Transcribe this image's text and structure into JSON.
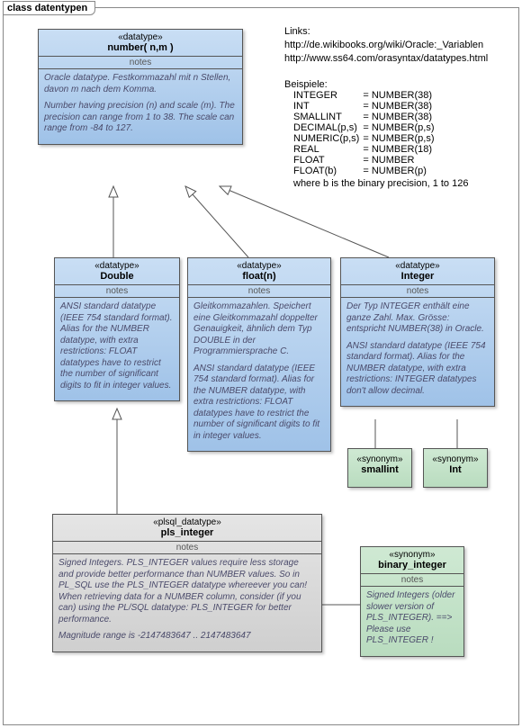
{
  "frame": {
    "title": "class datentypen"
  },
  "links_heading": "Links:",
  "links": [
    "http://de.wikibooks.org/wiki/Oracle:_Variablen",
    "http://www.ss64.com/orasyntax/datatypes.html"
  ],
  "examples": {
    "heading": "Beispiele:",
    "rows": [
      {
        "l": "INTEGER",
        "r": "= NUMBER(38)"
      },
      {
        "l": "INT",
        "r": "= NUMBER(38)"
      },
      {
        "l": "SMALLINT",
        "r": "= NUMBER(38)"
      },
      {
        "l": "DECIMAL(p,s)",
        "r": "= NUMBER(p,s)"
      },
      {
        "l": "NUMERIC(p,s)",
        "r": "= NUMBER(p,s)"
      },
      {
        "l": "REAL",
        "r": "= NUMBER(18)"
      },
      {
        "l": "FLOAT",
        "r": "= NUMBER"
      },
      {
        "l": "FLOAT(b)",
        "r": "= NUMBER(p)"
      }
    ],
    "footer": "where b is the binary precision, 1 to 126"
  },
  "notes_label": "notes",
  "classes": {
    "number": {
      "ster": "«datatype»",
      "name": "number( n,m )",
      "notes": [
        "Oracle datatype. Festkommazahl mit n Stellen, davon m nach dem Komma.",
        "Number having precision (n) and scale (m). The precision can range from 1 to 38. The scale can range from -84 to 127."
      ]
    },
    "double": {
      "ster": "«datatype»",
      "name": "Double",
      "notes": [
        "ANSI standard datatype (IEEE 754 standard format). Alias for the NUMBER datatype, with extra restrictions: FLOAT datatypes have to restrict the number of significant digits to fit in integer values."
      ]
    },
    "float": {
      "ster": "«datatype»",
      "name": "float(n)",
      "notes": [
        "Gleitkommazahlen. Speichert eine Gleitkommazahl doppelter Genauigkeit, ähnlich dem Typ DOUBLE in der Programmiersprache C.",
        "ANSI standard datatype (IEEE 754 standard format). Alias for the NUMBER datatype, with extra restrictions: FLOAT datatypes have to restrict the number of significant digits to fit in integer values."
      ]
    },
    "integer": {
      "ster": "«datatype»",
      "name": "Integer",
      "notes": [
        "Der Typ INTEGER enthält eine ganze Zahl. Max. Grösse: entspricht NUMBER(38) in Oracle.",
        "ANSI standard datatype (IEEE 754 standard format). Alias for the NUMBER datatype, with extra restrictions: INTEGER datatypes don't allow decimal."
      ]
    },
    "smallint": {
      "ster": "«synonym»",
      "name": "smallint"
    },
    "int": {
      "ster": "«synonym»",
      "name": "Int"
    },
    "pls": {
      "ster": "«plsql_datatype»",
      "name": "pls_integer",
      "notes": [
        "Signed Integers. PLS_INTEGER values require less storage and provide better performance than NUMBER values. So in PL_SQL use the PLS_INTEGER datatype whereever you can! When retrieving data for a NUMBER column, consider (if you can) using the PL/SQL datatype: PLS_INTEGER for better performance.",
        "Magnitude range is -2147483647 .. 2147483647"
      ]
    },
    "binint": {
      "ster": "«synonym»",
      "name": "binary_integer",
      "notes": [
        "Signed Integers (older slower version of PLS_INTEGER). ==> Please use PLS_INTEGER !"
      ]
    }
  }
}
